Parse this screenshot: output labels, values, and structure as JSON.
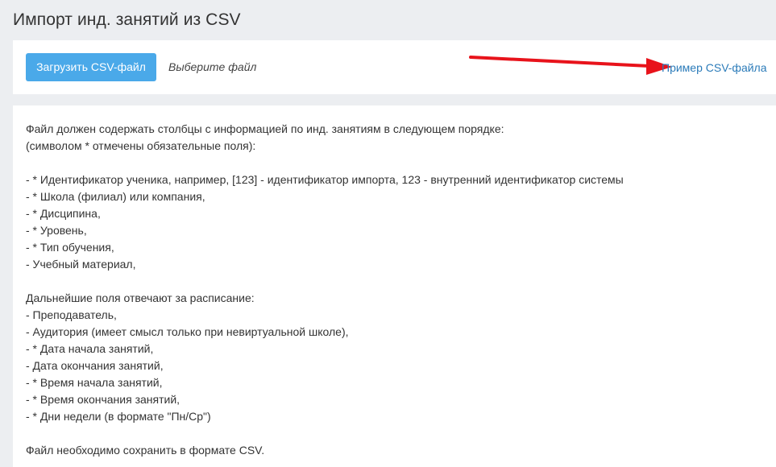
{
  "page": {
    "title": "Импорт инд. занятий из CSV"
  },
  "upload": {
    "button_label": "Загрузить CSV-файл",
    "file_hint": "Выберите файл",
    "example_link": "Пример CSV-файла",
    "annotation_color": "#e8131b"
  },
  "instructions": {
    "lines": [
      "Файл должен содержать столбцы с информацией по инд. занятиям в следующем порядке:",
      "(символом * отмечены обязательные поля):",
      "",
      "- * Идентификатор ученика, например, [123] - идентификатор импорта, 123 - внутренний идентификатор системы",
      "- * Школа (филиал) или компания,",
      "- * Дисципина,",
      "- * Уровень,",
      "- * Тип обучения,",
      "- Учебный материал,",
      "",
      "Дальнейшие поля отвечают за расписание:",
      "- Преподаватель,",
      "- Аудитория (имеет смысл только при невиртуальной школе),",
      "- * Дата начала занятий,",
      "- Дата окончания занятий,",
      "- * Время начала занятий,",
      "- * Время окончания занятий,",
      "- * Дни недели (в формате \"Пн/Ср\")",
      "",
      "Файл необходимо сохранить в формате CSV."
    ]
  }
}
